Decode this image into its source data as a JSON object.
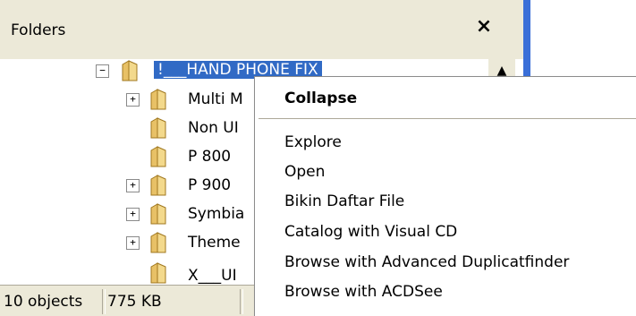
{
  "folders_pane": {
    "title": "Folders",
    "close_glyph": "×",
    "scroll_up_glyph": "▲",
    "folder_color": "#e8c166",
    "selection_color": "#316ac5"
  },
  "tree": {
    "root": {
      "label": "!___HAND PHONE FIX",
      "expander": "−",
      "selected": true
    },
    "children": [
      {
        "label": "Multi M",
        "expander": "+"
      },
      {
        "label": "Non UI",
        "expander": ""
      },
      {
        "label": "P 800",
        "expander": ""
      },
      {
        "label": "P 900",
        "expander": "+"
      },
      {
        "label": "Symbia",
        "expander": "+"
      },
      {
        "label": "Theme",
        "expander": "+"
      },
      {
        "label": "X___UI",
        "expander": ""
      }
    ]
  },
  "status_bar": {
    "objects": "10 objects",
    "size": "775 KB"
  },
  "context_menu": {
    "items": [
      {
        "label": "Collapse",
        "bold": true
      },
      {
        "label": "Explore"
      },
      {
        "label": "Open"
      },
      {
        "label": "Bikin Daftar File"
      },
      {
        "label": "Catalog with Visual CD"
      },
      {
        "label": "Browse with Advanced Duplicatfinder"
      },
      {
        "label": "Browse with ACDSee"
      }
    ]
  }
}
